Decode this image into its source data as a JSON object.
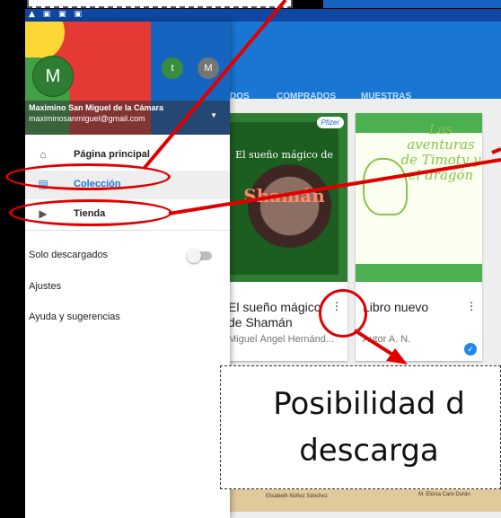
{
  "drawer": {
    "account_initial": "M",
    "account_small_1": "t",
    "account_small_2": "M",
    "account_name": "Maximino San Miguel de la Cámara",
    "account_email": "maximinosanmiguel@gmail.com",
    "nav": [
      {
        "label": "Página principal",
        "icon": "home-icon"
      },
      {
        "label": "Colección",
        "icon": "library-icon"
      },
      {
        "label": "Tienda",
        "icon": "store-icon"
      }
    ],
    "toggle_label": "Solo descargados",
    "settings_label": "Ajustes",
    "help_label": "Ayuda y sugerencias"
  },
  "appbar": {
    "tabs": [
      "DOS",
      "COMPRADOS",
      "MUESTRAS"
    ]
  },
  "books": [
    {
      "title": "El sueño mágico de Shamán",
      "author": "Miguel Ángel Hernánd...",
      "cover_top": "El sueño mágico de",
      "cover_big": "Shamán",
      "badge": "Pfizer"
    },
    {
      "title": "Libro nuevo",
      "author": "Autor A. N.",
      "cover_text": "Las aventuras de Timoty y el dragón"
    }
  ],
  "bottom_strip": [
    "Elisabeth Núñez Sánchez",
    "M. Eloísa Caro Durán"
  ],
  "annotation": {
    "line1": "Posibilidad d",
    "line2": "descarga"
  },
  "colors": {
    "appbar": "#1976d2",
    "statusbar": "#0d47a1",
    "active": "#1976d2",
    "annotation": "#e00000"
  }
}
